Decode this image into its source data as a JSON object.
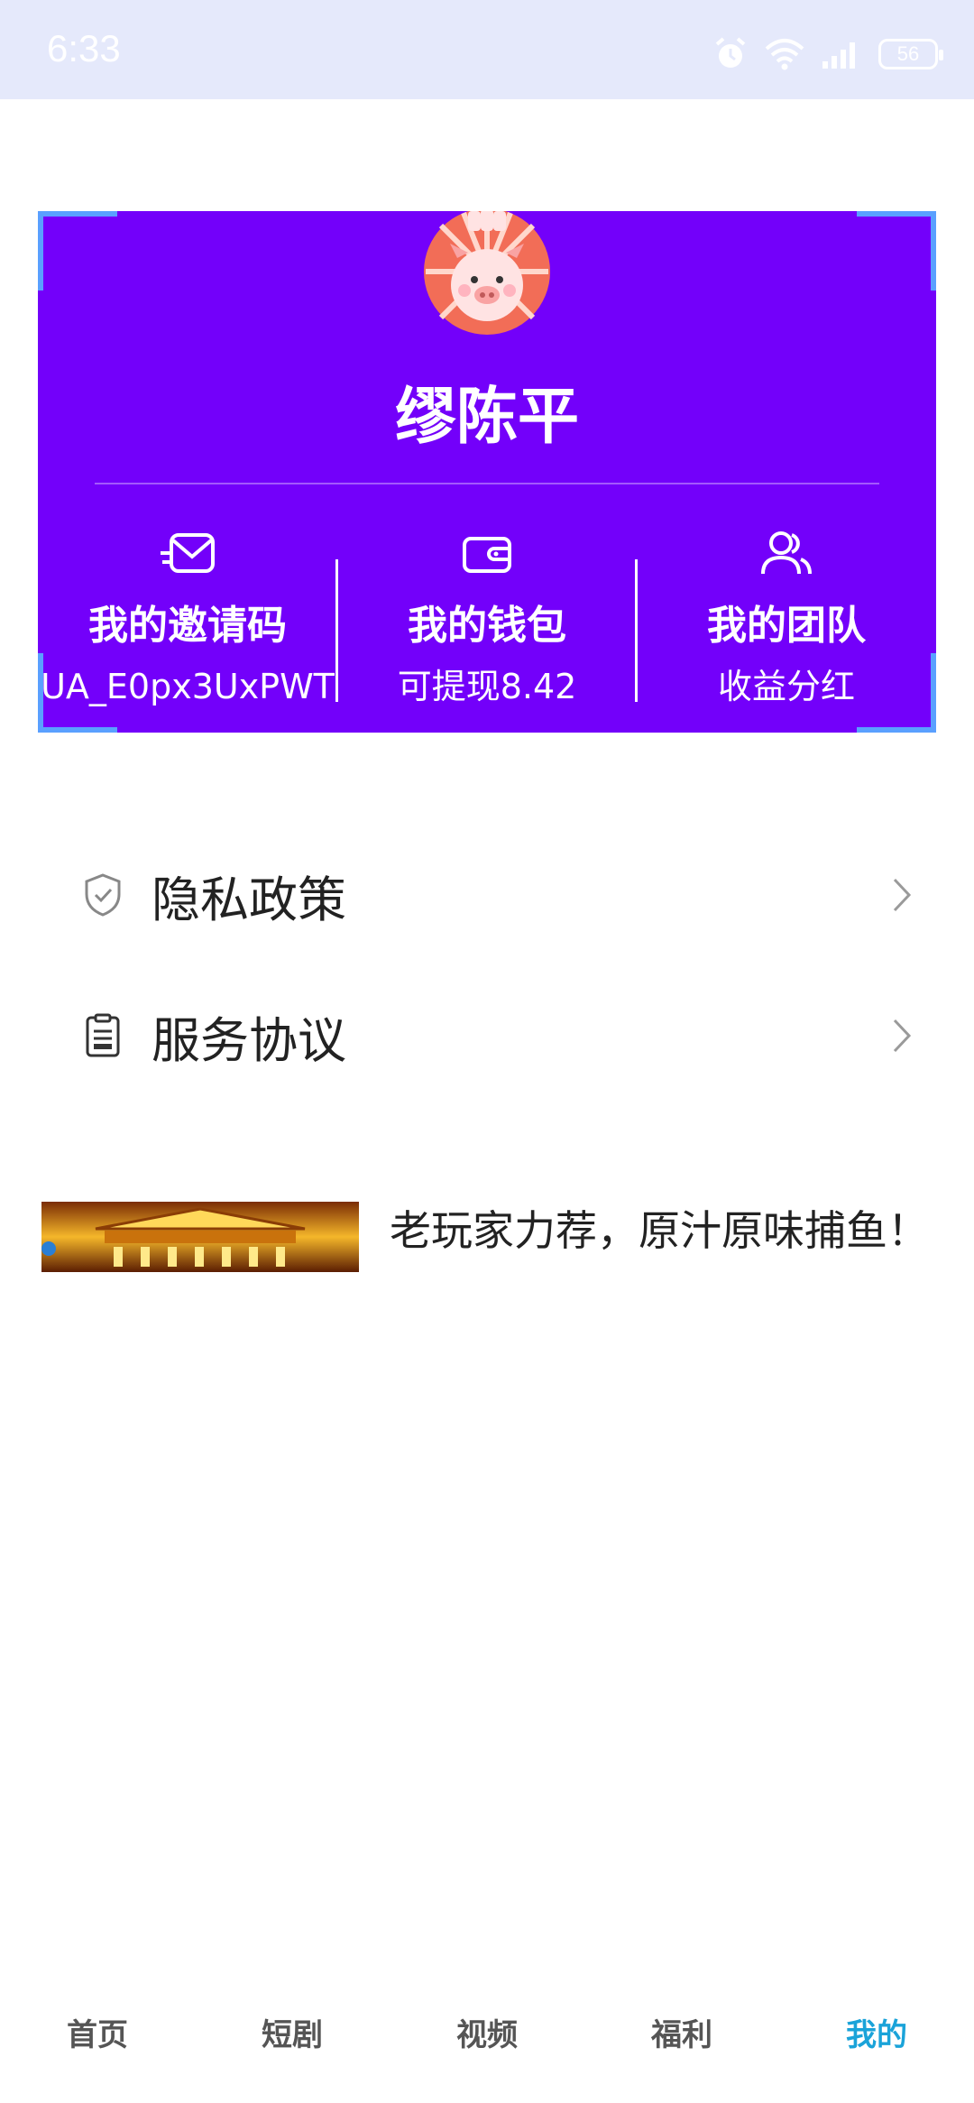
{
  "status_bar": {
    "time": "6:33",
    "battery": "56",
    "icons": [
      "alarm-icon",
      "wifi-icon",
      "signal-icon",
      "battery-icon"
    ]
  },
  "profile": {
    "name": "缪陈平",
    "avatar_icon": "pig-avatar-icon",
    "items": [
      {
        "title": "我的邀请码",
        "sub": "UA_E0px3UxPWT",
        "icon": "mail-icon"
      },
      {
        "title": "我的钱包",
        "sub": "可提现8.42",
        "icon": "wallet-icon"
      },
      {
        "title": "我的团队",
        "sub": "收益分红",
        "icon": "team-icon"
      }
    ]
  },
  "menu": [
    {
      "label": "隐私政策",
      "icon": "shield-icon"
    },
    {
      "label": "服务协议",
      "icon": "document-icon"
    }
  ],
  "article": {
    "title": "老玩家力荐，原汁原味捕鱼！"
  },
  "nav": {
    "items": [
      "首页",
      "短剧",
      "视频",
      "福利",
      "我的"
    ],
    "active_index": 4
  },
  "colors": {
    "card": "#7300fa",
    "corner_accent": "#5aa0ff",
    "nav_active": "#1aa3d9",
    "status_bar": "#e5e9fb"
  }
}
